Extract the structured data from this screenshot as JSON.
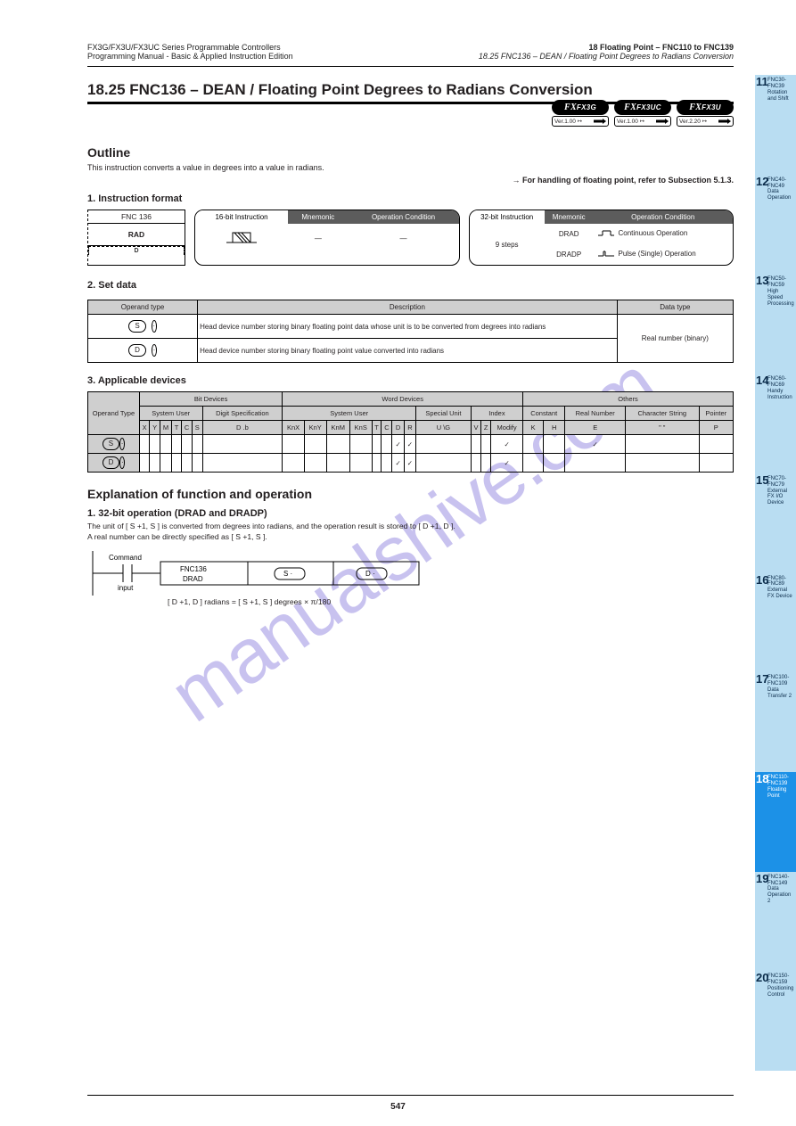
{
  "meta": {
    "pageNumber": "547"
  },
  "header": {
    "leftTop": "FX3G/FX3U/FX3UC Series Programmable Controllers",
    "leftBottom": "Programming Manual - Basic & Applied Instruction Edition",
    "rightTop": "18 Floating Point – FNC110 to FNC139",
    "rightBottom": "18.25 FNC136 – DEAN / Floating Point Degrees to Radians Conversion"
  },
  "titles": {
    "section": "18.25  FNC136 – DEAN / Floating Point Degrees to Radians Conversion",
    "outline": "Outline",
    "format": "1. Instruction format",
    "setData": "2. Set data",
    "targets": "3. Applicable devices",
    "explanation": "Explanation of function and operation",
    "exp1": "1. 32-bit operation (DRAD and DRADP)"
  },
  "body": {
    "outline": "This instruction converts a value in degrees into a value in radians.",
    "forHandling": "→ For handling of floating point, refer to Subsection 5.1.3.",
    "expText": "The unit of [ S +1, S ] is converted from degrees into radians, and the operation result is stored to [ D +1, D ].\nA real number can be directly specified as [ S +1, S ].",
    "formula": "[ D +1, D ] radians = [ S +1, S ] degrees × π/180"
  },
  "badges": [
    {
      "top": "FX3G",
      "bot": "Ver.1.00 ↦"
    },
    {
      "top": "FX3UC",
      "bot": "Ver.1.00 ↦"
    },
    {
      "top": "FX3U",
      "bot": "Ver.2.20 ↦"
    }
  ],
  "fncBox": {
    "r1": "FNC 136",
    "r2": "RAD",
    "r3": "D"
  },
  "boxes": {
    "b16": {
      "headers": [
        "16-bit Instruction",
        "Mnemonic",
        "Operation Condition"
      ],
      "mnemonic": "—",
      "cond": "—"
    },
    "b32": {
      "headers": [
        "32-bit Instruction",
        "Mnemonic",
        "Operation Condition"
      ],
      "rows": [
        {
          "steps": "9 steps",
          "m": "DRAD",
          "c": "Continuous Operation"
        },
        {
          "steps": "",
          "m": "DRADP",
          "c": "Pulse (Single) Operation"
        }
      ]
    }
  },
  "setData": {
    "headers": [
      "Operand type",
      "Description",
      "Data type"
    ],
    "rows": [
      {
        "pills": [
          "S",
          "·"
        ],
        "desc": "Head device number storing binary floating point data whose unit is to be converted from degrees into radians",
        "type": "Real number (binary)"
      },
      {
        "pills": [
          "D",
          "·"
        ],
        "desc": "Head device number storing binary floating point value converted into radians",
        "type": "Real number (binary)"
      }
    ]
  },
  "targets": {
    "groupHeaders": [
      "Operand Type",
      "Bit Devices",
      "Word Devices",
      "Others"
    ],
    "subHeaders": {
      "bit": [
        "System User",
        "Digit Specification"
      ],
      "word": [
        "System User",
        "Special Unit",
        "Index"
      ],
      "others": [
        "Constant",
        "Real Number",
        "Character String",
        "Pointer"
      ]
    },
    "cols": [
      "X",
      "Y",
      "M",
      "T",
      "C",
      "S",
      "D .b",
      "KnX",
      "KnY",
      "KnM",
      "KnS",
      "T",
      "C",
      "D",
      "R",
      "U \\G",
      "V",
      "Z",
      "Modify",
      "K",
      "H",
      "E",
      "\" \"",
      "P"
    ],
    "rows": [
      {
        "label": "S  ·",
        "cells": [
          "",
          "",
          "",
          "",
          "",
          "",
          "",
          "",
          "",
          "",
          "",
          "",
          "",
          "✓",
          "✓",
          "",
          "",
          "",
          "✓",
          "",
          "",
          "✓",
          "",
          ""
        ]
      },
      {
        "label": "D  ·",
        "cells": [
          "",
          "",
          "",
          "",
          "",
          "",
          "",
          "",
          "",
          "",
          "",
          "",
          "",
          "✓",
          "✓",
          "",
          "",
          "",
          "✓",
          "",
          "",
          "",
          "",
          ""
        ]
      }
    ]
  },
  "ladder": {
    "command": "Command input",
    "fnc": "FNC136",
    "fncName": "DRAD",
    "s": "S  ·",
    "d": "D  ·"
  },
  "tabs": [
    {
      "n": "11",
      "t": "FNC30-FNC39 Rotation and Shift"
    },
    {
      "n": "12",
      "t": "FNC40-FNC49 Data Operation"
    },
    {
      "n": "13",
      "t": "FNC50-FNC59 High Speed Processing"
    },
    {
      "n": "14",
      "t": "FNC60-FNC69 Handy Instruction"
    },
    {
      "n": "15",
      "t": "FNC70-FNC79 External FX I/O Device"
    },
    {
      "n": "16",
      "t": "FNC80-FNC89 External FX Device"
    },
    {
      "n": "17",
      "t": "FNC100-FNC109 Data Transfer 2"
    },
    {
      "n": "18",
      "t": "FNC110-FNC139 Floating Point",
      "active": true
    },
    {
      "n": "19",
      "t": "FNC140-FNC149 Data Operation 2"
    },
    {
      "n": "20",
      "t": "FNC150-FNC159 Positioning Control"
    }
  ],
  "watermark": "manualshive.com"
}
